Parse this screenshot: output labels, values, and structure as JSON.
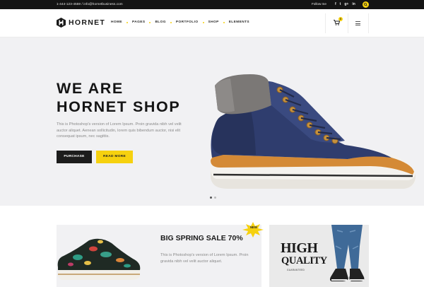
{
  "topbar": {
    "contact": "1-444-123-4559 / info@hornetbusiness.com",
    "follow_label": "Follow me",
    "socials": [
      "f",
      "t",
      "g+",
      "in"
    ]
  },
  "header": {
    "logo": "HORNET",
    "nav": [
      "HOME",
      "PAGES",
      "BLOG",
      "PORTFOLIO",
      "SHOP",
      "ELEMENTS"
    ],
    "cart_count": "0"
  },
  "hero": {
    "title_line1": "WE ARE",
    "title_line2": "HORNET SHOP",
    "description": "This is Photoshop's version of Lorem Ipsum. Proin gravida nibh vel velit auctor aliquet. Aenean sollicitudin, lorem quis bibendum auctor, nisi elit consequat ipsum, nec sagittis.",
    "btn_purchase": "PURCHASE",
    "btn_read_more": "READ MORE",
    "slides": 2,
    "active_slide": 1
  },
  "promo_left": {
    "badge": "NEW",
    "title": "BIG SPRING SALE 70%",
    "text": "This is Photoshop's version of Lorem Ipsum. Proin gravida nibh vel velit auctor aliquet."
  },
  "promo_right": {
    "high": "HIGH",
    "quality": "QUALITY",
    "guaranteed": "GUARANTEED"
  },
  "colors": {
    "accent": "#f6d10f",
    "dark": "#1c1c1c",
    "hero_bg": "#f1f1f3"
  }
}
